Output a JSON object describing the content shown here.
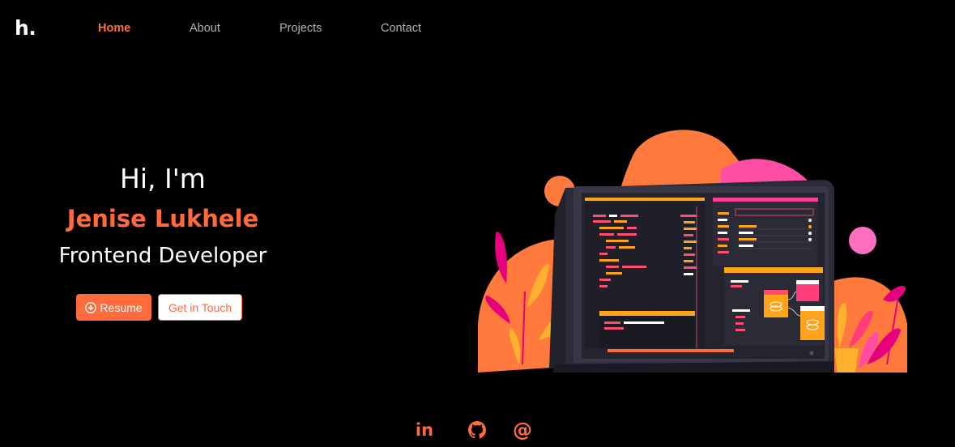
{
  "logo": {
    "text": "h."
  },
  "nav": {
    "items": [
      {
        "label": "Home",
        "active": true
      },
      {
        "label": "About",
        "active": false
      },
      {
        "label": "Projects",
        "active": false
      },
      {
        "label": "Contact",
        "active": false
      }
    ]
  },
  "hero": {
    "greeting": "Hi, I'm",
    "name": "Jenise Lukhele",
    "role": "Frontend Developer",
    "resume_button": "Resume",
    "contact_button": "Get in Touch"
  },
  "illustration": {
    "icon": "laptop-code-illustration"
  },
  "socials": {
    "linkedin": "in",
    "github_icon": "github-icon",
    "email": "@"
  },
  "colors": {
    "background": "#000000",
    "accent": "#ff6b3d",
    "nav_text": "#b3b3b3",
    "text": "#ffffff"
  }
}
